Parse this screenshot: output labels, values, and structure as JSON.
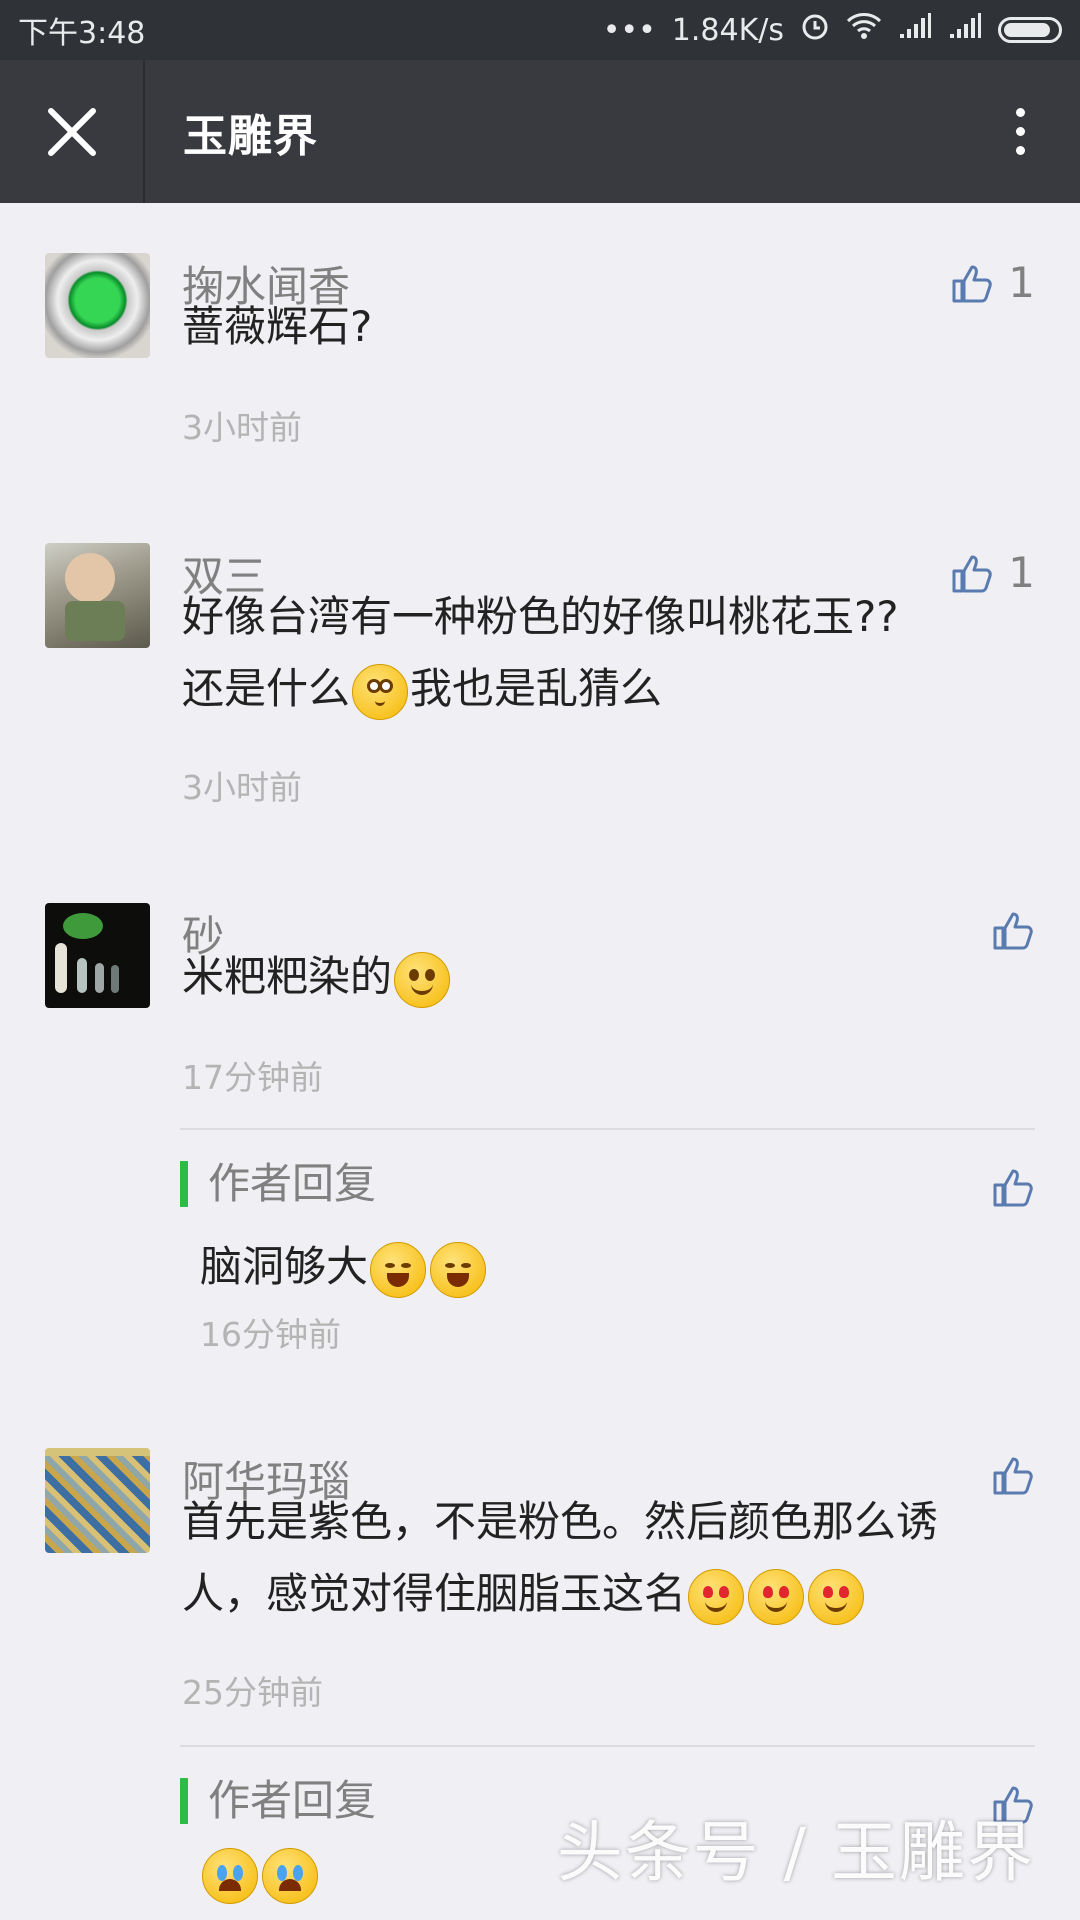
{
  "status_bar": {
    "time": "下午3:48",
    "dots": "•••",
    "net_speed": "1.84K/s",
    "icons": [
      "alarm-icon",
      "wifi-icon",
      "signal-icon",
      "signal-icon",
      "battery-icon"
    ]
  },
  "header": {
    "title": "玉雕界",
    "close_icon": "close-icon",
    "more_icon": "more-vertical-icon"
  },
  "comments": [
    {
      "name": "掬水闻香",
      "text": "蔷薇辉石?",
      "time": "3小时前",
      "likes": "1",
      "avatar": "green-jade-ring"
    },
    {
      "name": "双三",
      "text_line1": "好像台湾有一种粉色的好像叫桃花玉??",
      "text_line2_a": "还是什么",
      "text_line2_b": "我也是乱猜么",
      "time": "3小时前",
      "likes": "1",
      "avatar": "crying-child"
    },
    {
      "name": "砂",
      "text": "米粑粑染的",
      "time": "17分钟前",
      "avatar": "dark-figurines",
      "reply": {
        "label": "作者回复",
        "text": "脑洞够大",
        "time": "16分钟前"
      }
    },
    {
      "name": "阿华玛瑙",
      "text_line1": "首先是紫色，不是粉色。然后颜色那么诱",
      "text_line2": "人，感觉对得住胭脂玉这名",
      "time": "25分钟前",
      "avatar": "agate-carving",
      "reply": {
        "label": "作者回复"
      }
    }
  ],
  "watermark": "头条号 / 玉雕界",
  "colors": {
    "title_bar": "#393a3f",
    "status_bar": "#2f3236",
    "background": "#efeff4",
    "reply_accent": "#2fbb47"
  }
}
